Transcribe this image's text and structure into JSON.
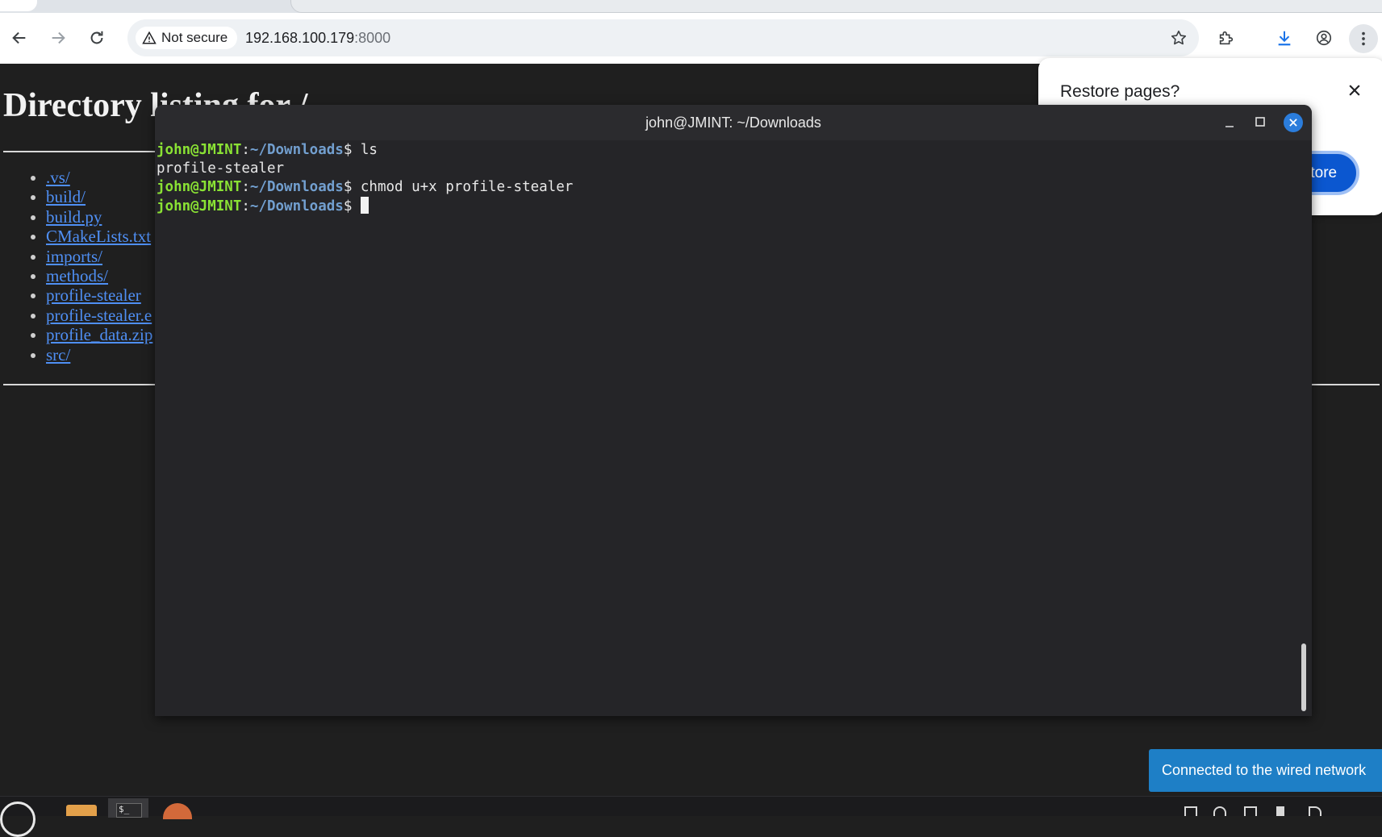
{
  "browser": {
    "security_label": "Not secure",
    "url_host": "192.168.100.179",
    "url_port": ":8000"
  },
  "page": {
    "title": "Directory listing for /",
    "files": [
      ".vs/",
      "build/",
      "build.py",
      "CMakeLists.txt",
      "imports/",
      "methods/",
      "profile-stealer",
      "profile-stealer.e",
      "profile_data.zip",
      "src/"
    ]
  },
  "restore_bubble": {
    "title": "Restore pages?",
    "button_label": "store"
  },
  "terminal": {
    "title": "john@JMINT: ~/Downloads",
    "prompt_user": "john@JMINT",
    "prompt_sep": ":",
    "prompt_path": "~/Downloads",
    "prompt_end": "$ ",
    "cmd1": "ls",
    "out1": "profile-stealer",
    "cmd2": "chmod u+x profile-stealer",
    "cmd3": ""
  },
  "notification": {
    "text": "Connected to the wired network"
  },
  "taskbar": {
    "terminal_glyph": "$_"
  }
}
